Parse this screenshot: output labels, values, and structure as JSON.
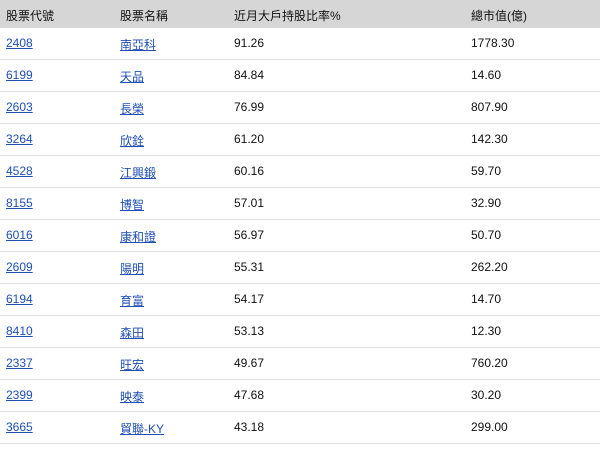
{
  "header": {
    "code": "股票代號",
    "name": "股票名稱",
    "ratio": "近月大戶持股比率%",
    "cap": "總市值(億)"
  },
  "rows": [
    {
      "code": "2408",
      "name": "南亞科",
      "ratio": "91.26",
      "cap": "1778.30"
    },
    {
      "code": "6199",
      "name": "天品",
      "ratio": "84.84",
      "cap": "14.60"
    },
    {
      "code": "2603",
      "name": "長榮",
      "ratio": "76.99",
      "cap": "807.90"
    },
    {
      "code": "3264",
      "name": "欣銓",
      "ratio": "61.20",
      "cap": "142.30"
    },
    {
      "code": "4528",
      "name": "江興鍛",
      "ratio": "60.16",
      "cap": "59.70"
    },
    {
      "code": "8155",
      "name": "博智",
      "ratio": "57.01",
      "cap": "32.90"
    },
    {
      "code": "6016",
      "name": "康和證",
      "ratio": "56.97",
      "cap": "50.70"
    },
    {
      "code": "2609",
      "name": "陽明",
      "ratio": "55.31",
      "cap": "262.20"
    },
    {
      "code": "6194",
      "name": "育富",
      "ratio": "54.17",
      "cap": "14.70"
    },
    {
      "code": "8410",
      "name": "森田",
      "ratio": "53.13",
      "cap": "12.30"
    },
    {
      "code": "2337",
      "name": "旺宏",
      "ratio": "49.67",
      "cap": "760.20"
    },
    {
      "code": "2399",
      "name": "映泰",
      "ratio": "47.68",
      "cap": "30.20"
    },
    {
      "code": "3665",
      "name": "貿聯-KY",
      "ratio": "43.18",
      "cap": "299.00"
    }
  ]
}
